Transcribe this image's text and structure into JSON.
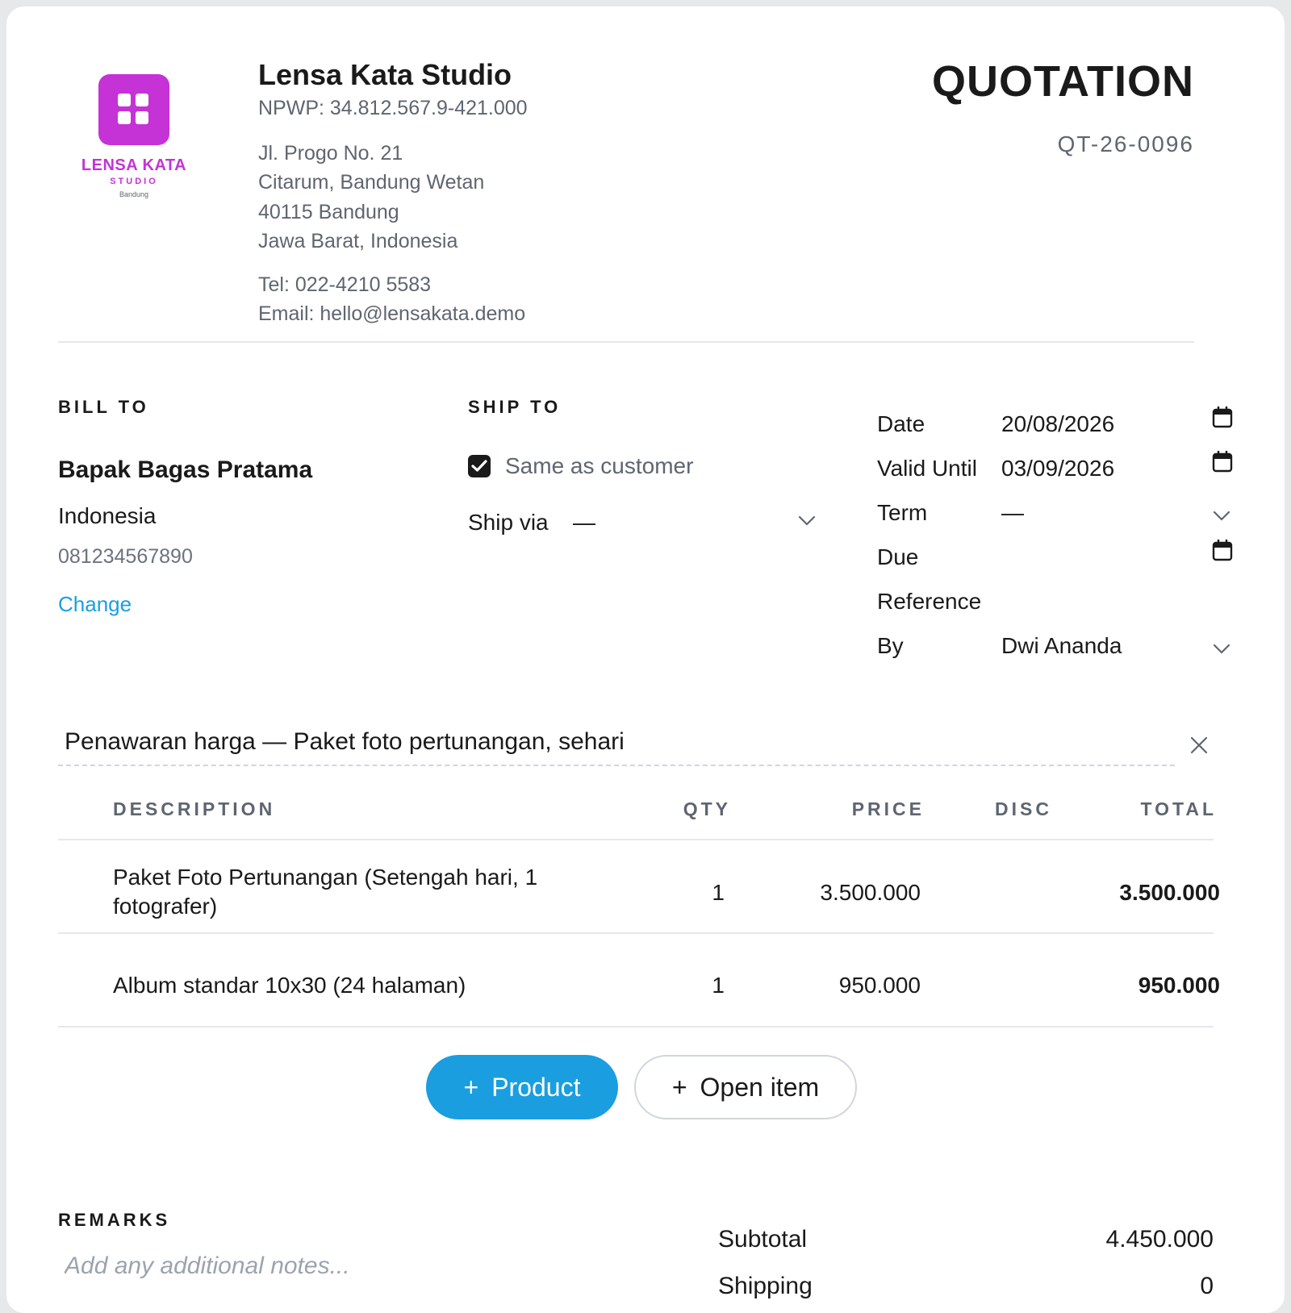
{
  "company": {
    "logo_name": "LENSA KATA",
    "logo_sub": "STUDIO",
    "logo_city": "Bandung",
    "name": "Lensa Kata Studio",
    "npwp": "NPWP: 34.812.567.9-421.000",
    "address": [
      "Jl. Progo No. 21",
      "Citarum, Bandung Wetan",
      "40115 Bandung",
      "Jawa Barat, Indonesia"
    ],
    "tel": "Tel: 022-4210 5583",
    "email": "Email: hello@lensakata.demo"
  },
  "document": {
    "title": "QUOTATION",
    "number": "QT-26-0096"
  },
  "bill_to": {
    "heading": "BILL TO",
    "name": "Bapak Bagas Pratama",
    "country": "Indonesia",
    "phone": "081234567890",
    "change_label": "Change"
  },
  "ship_to": {
    "heading": "SHIP TO",
    "same_label": "Same as customer",
    "same_checked": true,
    "ship_via_label": "Ship via",
    "ship_via_value": "—"
  },
  "meta": {
    "date_label": "Date",
    "date_value": "20/08/2026",
    "valid_label": "Valid Until",
    "valid_value": "03/09/2026",
    "term_label": "Term",
    "term_value": "—",
    "due_label": "Due",
    "reference_label": "Reference",
    "by_label": "By",
    "by_value": "Dwi Ananda"
  },
  "subject": "Penawaran harga — Paket foto pertunangan, sehari",
  "table": {
    "headers": {
      "description": "DESCRIPTION",
      "qty": "QTY",
      "price": "PRICE",
      "disc": "DISC",
      "total": "TOTAL"
    },
    "rows": [
      {
        "description_line1": "Paket Foto Pertunangan (Setengah hari, 1",
        "description_line2": "fotografer)",
        "qty": "1",
        "price": "3.500.000",
        "disc": "",
        "total": "3.500.000"
      },
      {
        "description_line1": "Album standar 10x30 (24 halaman)",
        "qty": "1",
        "price": "950.000",
        "disc": "",
        "total": "950.000"
      }
    ]
  },
  "buttons": {
    "add_product": "Product",
    "add_open_item": "Open item",
    "plus": "+"
  },
  "remarks": {
    "heading": "REMARKS",
    "placeholder": "Add any additional notes..."
  },
  "summary": {
    "subtotal_label": "Subtotal",
    "subtotal_value": "4.450.000",
    "shipping_label": "Shipping",
    "shipping_value": "0"
  },
  "colors": {
    "accent": "#1a9ee0",
    "brand": "#c532d6"
  }
}
